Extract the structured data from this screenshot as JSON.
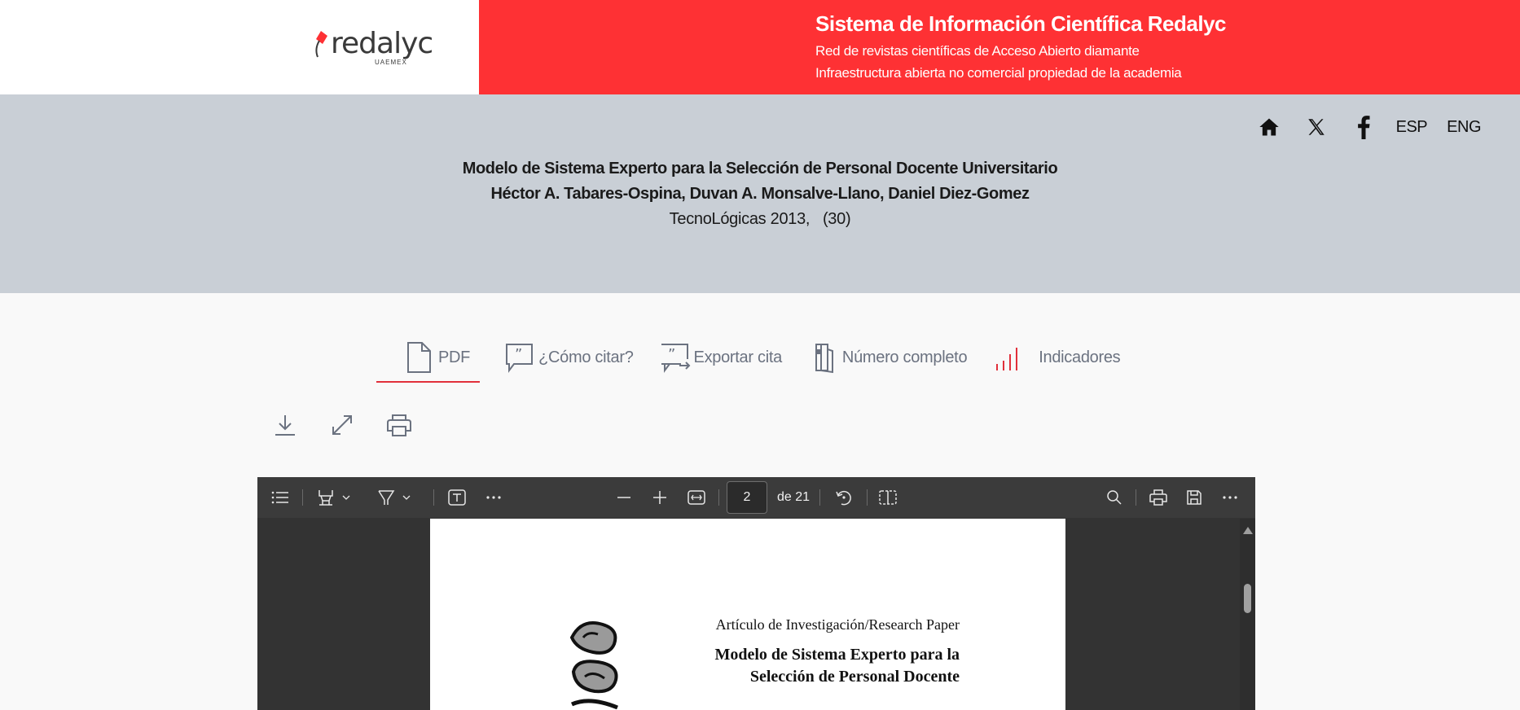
{
  "header": {
    "logo_text": "redalyc",
    "logo_sub": "UAEMEX",
    "site_title": "Sistema de Información Científica Redalyc",
    "tagline_1": "Red de revistas científicas de Acceso Abierto diamante",
    "tagline_2": "Infraestructura abierta no comercial propiedad de la academia",
    "accent_color": "#fe3134"
  },
  "nav": {
    "icons": [
      "home-icon",
      "x-twitter-icon",
      "facebook-icon"
    ],
    "lang_es": "ESP",
    "lang_en": "ENG"
  },
  "article": {
    "title": "Modelo de Sistema Experto para la Selección de Personal Docente Universitario",
    "authors": "Héctor A. Tabares-Ospina, Duvan A. Monsalve-Llano, Daniel Diez-Gomez",
    "journal": "TecnoLógicas 2013,   (30)"
  },
  "tabs": [
    {
      "label": "PDF",
      "icon": "pdf-file-icon",
      "active": true
    },
    {
      "label": "¿Cómo citar?",
      "icon": "quote-icon",
      "active": false
    },
    {
      "label": "Exportar cita",
      "icon": "export-quote-icon",
      "active": false
    },
    {
      "label": "Número completo",
      "icon": "issue-book-icon",
      "active": false
    },
    {
      "label": "Indicadores",
      "icon": "bar-chart-icon",
      "active": false
    }
  ],
  "tools": [
    "download-icon",
    "expand-icon",
    "print-icon"
  ],
  "viewer": {
    "current_page": "2",
    "page_of": "de 21",
    "pdf_type_line": "Artículo de Investigación/Research Paper",
    "pdf_title_1": "Modelo de Sistema Experto para la",
    "pdf_title_2": "Selección de Personal Docente"
  }
}
